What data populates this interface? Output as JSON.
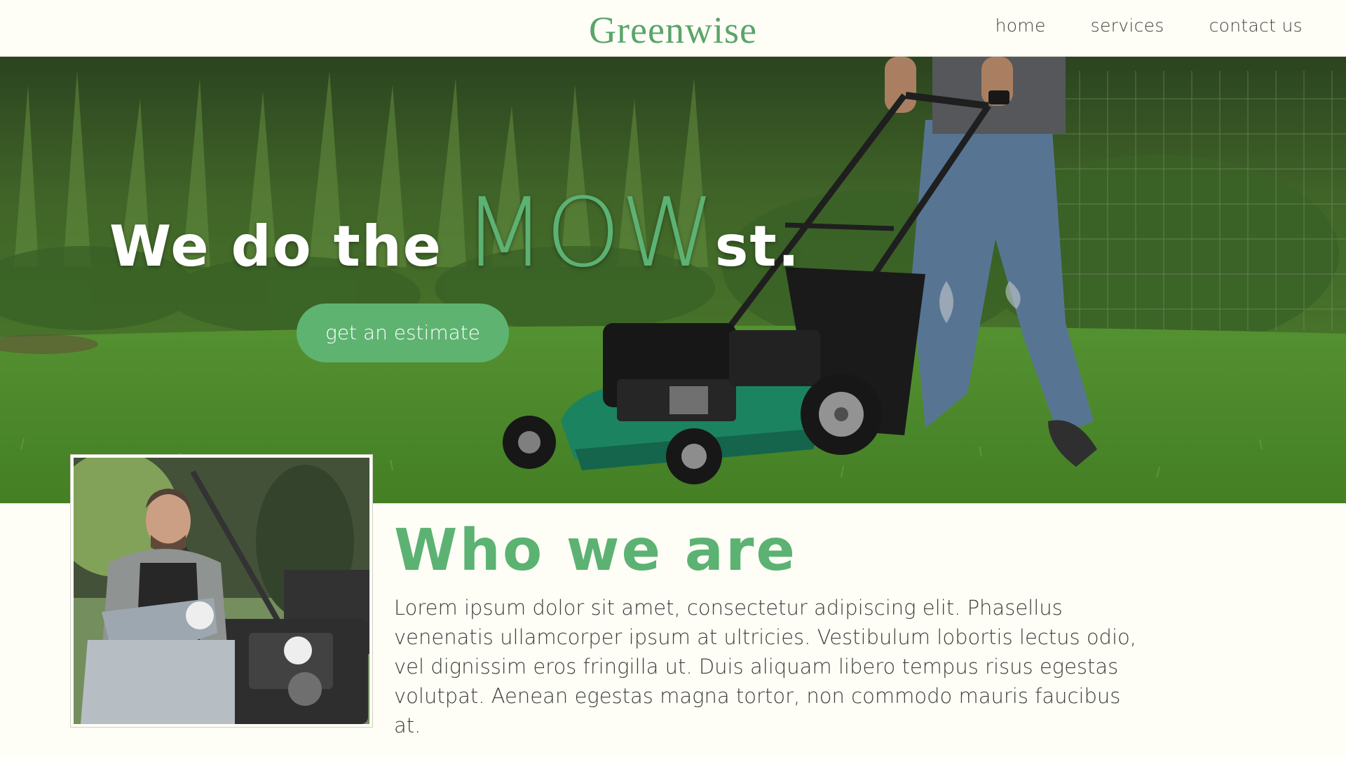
{
  "header": {
    "logo": "Greenwise",
    "nav": [
      {
        "label": "home"
      },
      {
        "label": "services"
      },
      {
        "label": "contact us"
      }
    ]
  },
  "hero": {
    "headline_prefix": "We do the ",
    "headline_highlight": "MOW",
    "headline_suffix": "st.",
    "cta_label": "get an estimate"
  },
  "about": {
    "title": "Who we are",
    "body": "Lorem ipsum dolor sit amet, consectetur adipiscing elit. Phasellus venenatis ullamcorper ipsum at ultricies. Vestibulum lobortis lectus odio, vel dignissim eros fringilla ut. Duis aliquam libero tempus risus egestas volutpat. Aenean egestas magna tortor, non commodo mauris faucibus at."
  },
  "colors": {
    "brand_green": "#5cb273",
    "background": "#fefef6",
    "text": "#3d3d3d"
  }
}
